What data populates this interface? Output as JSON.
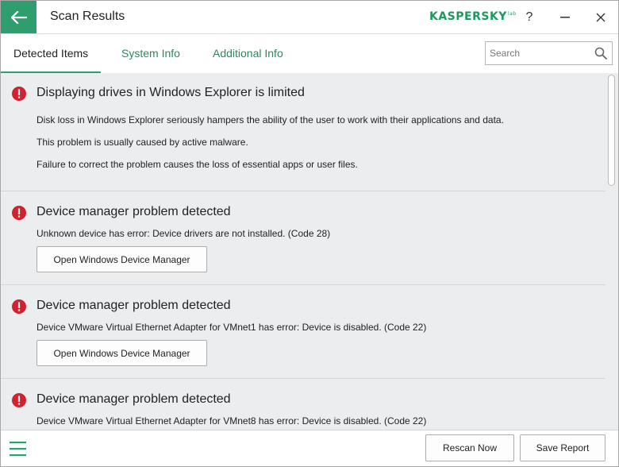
{
  "window": {
    "title": "Scan Results",
    "logo_text": "KASPERSKY",
    "logo_superscript": "lab",
    "help_label": "?",
    "minimize_label": "—",
    "close_label": "✕"
  },
  "tabs": [
    {
      "label": "Detected Items",
      "active": true
    },
    {
      "label": "System Info",
      "active": false
    },
    {
      "label": "Additional Info",
      "active": false
    }
  ],
  "search": {
    "placeholder": "Search",
    "value": ""
  },
  "items": [
    {
      "icon": "error-icon",
      "title": "Displaying drives in Windows Explorer is limited",
      "lines": [
        "Disk loss in Windows Explorer seriously hampers the ability of the user to work with their applications and data.",
        "This problem is usually caused by active malware.",
        "Failure to correct the problem causes the loss of essential apps or user files."
      ]
    },
    {
      "icon": "error-icon",
      "title": "Device manager problem detected",
      "lines": [
        "Unknown device has error: Device drivers are not installed. (Code 28)"
      ],
      "button_label": "Open Windows Device Manager"
    },
    {
      "icon": "error-icon",
      "title": "Device manager problem detected",
      "lines": [
        "Device VMware Virtual Ethernet Adapter for VMnet1 has error: Device is disabled. (Code 22)"
      ],
      "button_label": "Open Windows Device Manager"
    },
    {
      "icon": "error-icon",
      "title": "Device manager problem detected",
      "lines": [
        "Device VMware Virtual Ethernet Adapter for VMnet8 has error: Device is disabled. (Code 22)"
      ]
    }
  ],
  "footer": {
    "rescan_label": "Rescan Now",
    "save_label": "Save Report"
  },
  "colors": {
    "accent": "#2e9e6e",
    "error": "#d0232f",
    "content_bg": "#ebedee"
  }
}
